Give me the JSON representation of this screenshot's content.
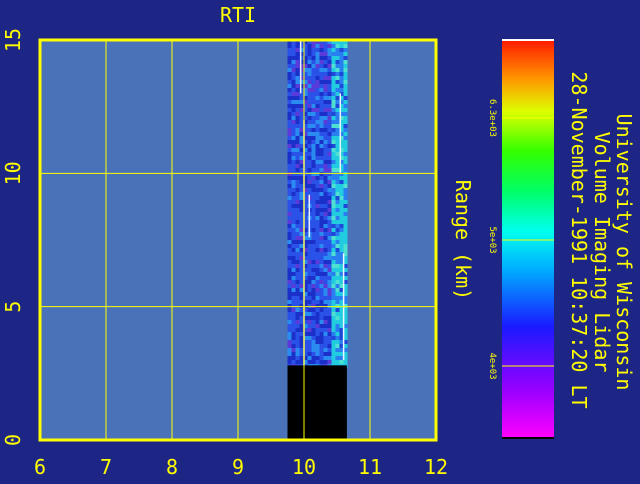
{
  "chart_data": {
    "type": "heatmap",
    "title": "RTI",
    "ylabel": "Range (km)",
    "xlabel": "",
    "x_ticks": [
      "6",
      "7",
      "8",
      "9",
      "10",
      "11",
      "12"
    ],
    "y_ticks": [
      "0",
      "5",
      "10",
      "15"
    ],
    "xlim": [
      6,
      12
    ],
    "ylim": [
      0,
      15
    ],
    "grid": true,
    "data_extent": {
      "x_start": 9.75,
      "x_end": 10.65,
      "y_start": 2.8,
      "y_end": 15
    },
    "blanked_region": {
      "x_start": 9.75,
      "x_end": 10.65,
      "y_start": 0,
      "y_end": 2.8
    },
    "colorbar": {
      "tick_labels": [
        "4e+03",
        "5e+03",
        "6.3e+03"
      ],
      "tick_values": [
        4000,
        5000,
        6300
      ]
    },
    "header_lines": [
      "University of Wisconsin",
      "Volume Imaging Lidar",
      "28-November-1991 10:37:20 LT"
    ]
  },
  "colors": {
    "background": "#1e2685",
    "plot_area": "#4a72b8",
    "frame": "#ffff00",
    "grid": "#ffff00",
    "text": "#ffff00",
    "blanked": "#000000"
  }
}
